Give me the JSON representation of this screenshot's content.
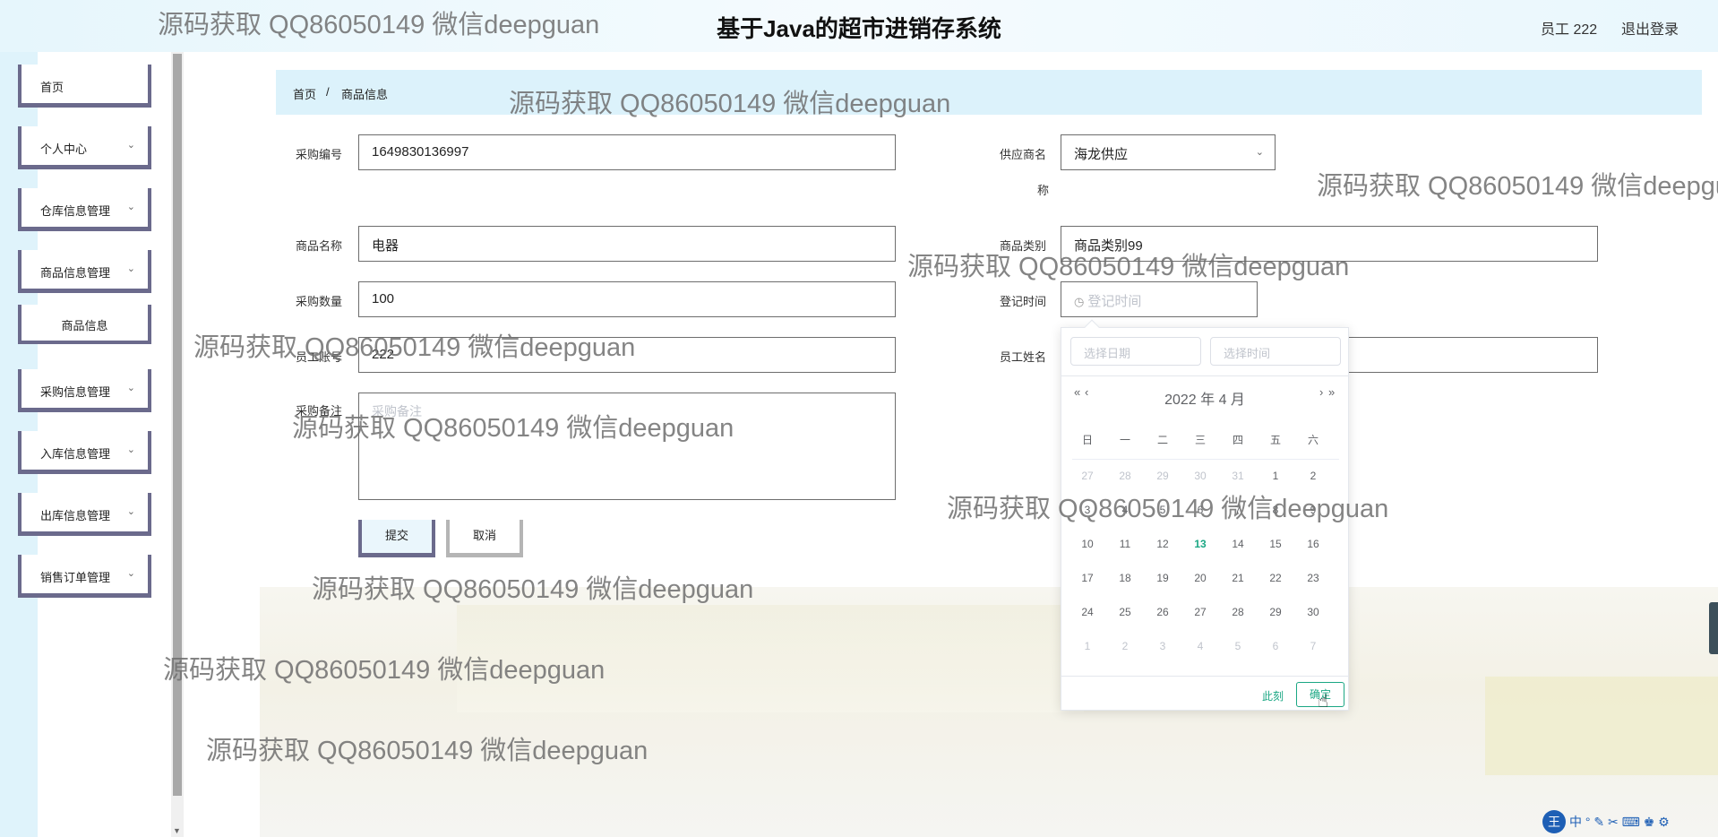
{
  "header": {
    "title": "基于Java的超市进销存系统",
    "user": "员工 222",
    "logout": "退出登录"
  },
  "sidebar": {
    "items": [
      {
        "label": "首页"
      },
      {
        "label": "个人中心"
      },
      {
        "label": "仓库信息管理"
      },
      {
        "label": "商品信息管理"
      },
      {
        "label": "商品信息"
      },
      {
        "label": "采购信息管理"
      },
      {
        "label": "入库信息管理"
      },
      {
        "label": "出库信息管理"
      },
      {
        "label": "销售订单管理"
      }
    ]
  },
  "breadcrumb": {
    "home": "首页",
    "separator": "/",
    "current": "商品信息"
  },
  "form": {
    "purchase_no": {
      "label": "采购编号",
      "value": "1649830136997"
    },
    "supplier": {
      "label_line1": "供应商名",
      "label_line2": "称",
      "value": "海龙供应"
    },
    "product_name": {
      "label": "商品名称",
      "value": "电器"
    },
    "category": {
      "label": "商品类别",
      "value": "商品类别99"
    },
    "quantity": {
      "label": "采购数量",
      "value": "100"
    },
    "register_time": {
      "label": "登记时间",
      "placeholder": "登记时间"
    },
    "employee_account": {
      "label": "员工账号",
      "value": "222"
    },
    "employee_name": {
      "label": "员工姓名",
      "value": ""
    },
    "remark": {
      "label": "采购备注",
      "placeholder": "采购备注"
    },
    "submit_label": "提交",
    "cancel_label": "取消"
  },
  "datepicker": {
    "date_placeholder": "选择日期",
    "time_placeholder": "选择时间",
    "prev_year": "«",
    "prev_month": "‹",
    "next_month": "›",
    "next_year": "»",
    "year_label": "2022 年",
    "month_label": "4 月",
    "weekdays": [
      "日",
      "一",
      "二",
      "三",
      "四",
      "五",
      "六"
    ],
    "weeks": [
      [
        {
          "d": "27",
          "dim": true
        },
        {
          "d": "28",
          "dim": true
        },
        {
          "d": "29",
          "dim": true
        },
        {
          "d": "30",
          "dim": true
        },
        {
          "d": "31",
          "dim": true
        },
        {
          "d": "1"
        },
        {
          "d": "2"
        }
      ],
      [
        {
          "d": "3"
        },
        {
          "d": "4"
        },
        {
          "d": "5"
        },
        {
          "d": "6"
        },
        {
          "d": "7"
        },
        {
          "d": "8"
        },
        {
          "d": "9"
        }
      ],
      [
        {
          "d": "10"
        },
        {
          "d": "11"
        },
        {
          "d": "12"
        },
        {
          "d": "13",
          "today": true
        },
        {
          "d": "14"
        },
        {
          "d": "15"
        },
        {
          "d": "16"
        }
      ],
      [
        {
          "d": "17"
        },
        {
          "d": "18"
        },
        {
          "d": "19"
        },
        {
          "d": "20"
        },
        {
          "d": "21"
        },
        {
          "d": "22"
        },
        {
          "d": "23"
        }
      ],
      [
        {
          "d": "24"
        },
        {
          "d": "25"
        },
        {
          "d": "26"
        },
        {
          "d": "27"
        },
        {
          "d": "28"
        },
        {
          "d": "29"
        },
        {
          "d": "30"
        }
      ],
      [
        {
          "d": "1",
          "dim": true
        },
        {
          "d": "2",
          "dim": true
        },
        {
          "d": "3",
          "dim": true
        },
        {
          "d": "4",
          "dim": true
        },
        {
          "d": "5",
          "dim": true
        },
        {
          "d": "6",
          "dim": true
        },
        {
          "d": "7",
          "dim": true
        }
      ]
    ],
    "now_label": "此刻",
    "ok_label": "确定"
  },
  "watermark": "源码获取 QQ86050149 微信deepguan",
  "ime": {
    "logo": "王",
    "mode": "中",
    "icons": "° ✎ ✂ ⌨ ♚ ⚙"
  },
  "colors": {
    "accent": "#1ba784",
    "sidebar_border": "#6b6a8c",
    "breadcrumb_bg": "#dcf2fb"
  }
}
